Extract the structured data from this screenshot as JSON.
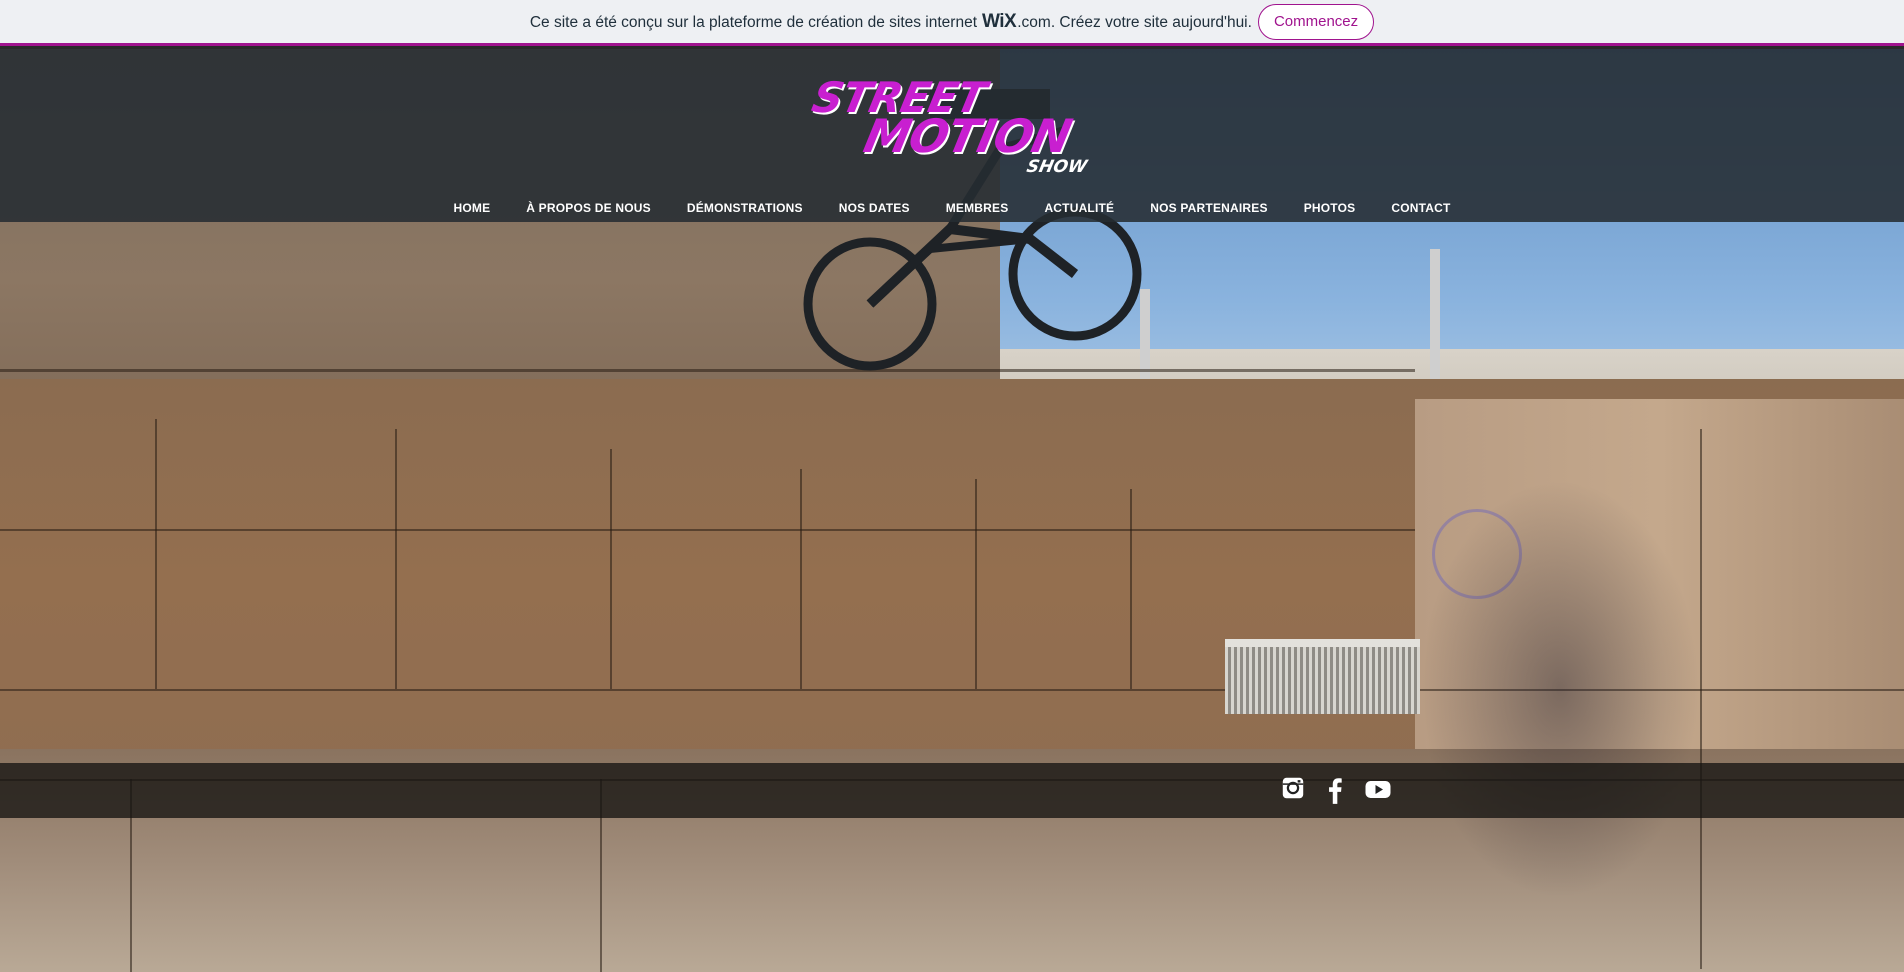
{
  "wix_banner": {
    "text_before": "Ce site a été conçu sur la plateforme de création de sites internet",
    "wix_word": "WiX",
    "text_after": ".com. Créez votre site aujourd'hui.",
    "button_label": "Commencez",
    "accent_color": "#a0138e"
  },
  "logo": {
    "line1": "STREET",
    "line2": "MOTION",
    "line3": "SHOW",
    "color": "#c81fd0"
  },
  "nav": {
    "items": [
      {
        "label": "HOME"
      },
      {
        "label": "À PROPOS DE NOUS"
      },
      {
        "label": "DÉMONSTRATIONS"
      },
      {
        "label": "NOS DATES"
      },
      {
        "label": "MEMBRES"
      },
      {
        "label": "ACTUALITÉ"
      },
      {
        "label": "NOS PARTENAIRES"
      },
      {
        "label": "PHOTOS"
      },
      {
        "label": "CONTACT"
      }
    ]
  },
  "social": {
    "icons": [
      "instagram-icon",
      "facebook-icon",
      "youtube-icon"
    ]
  }
}
